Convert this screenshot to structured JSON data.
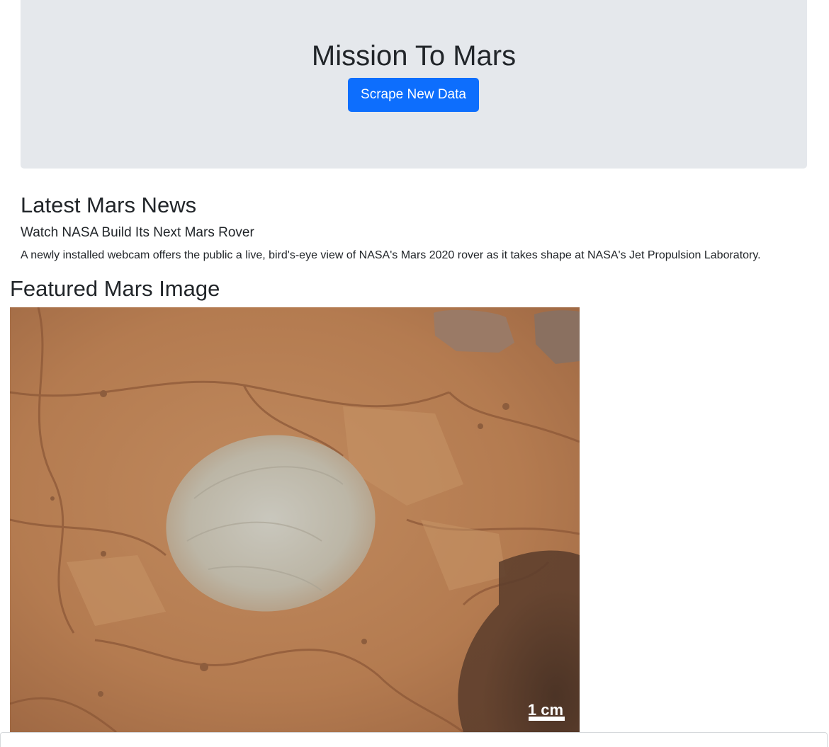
{
  "header": {
    "title": "Mission To Mars",
    "scrape_button_label": "Scrape New Data"
  },
  "news": {
    "section_title": "Latest Mars News",
    "headline": "Watch NASA Build Its Next Mars Rover",
    "teaser": "A newly installed webcam offers the public a live, bird's-eye view of NASA's Mars 2020 rover as it takes shape at NASA's Jet Propulsion Laboratory."
  },
  "featured": {
    "section_title": "Featured Mars Image",
    "scale_label": "1 cm"
  },
  "colors": {
    "button_primary": "#0d6efd",
    "jumbotron_bg": "#e5e8ec",
    "text_dark": "#212529"
  }
}
